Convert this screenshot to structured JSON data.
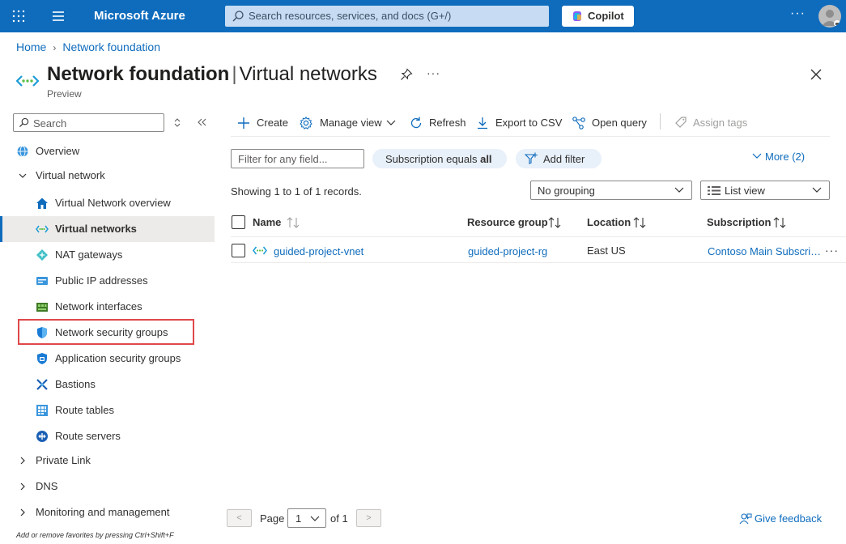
{
  "topbar": {
    "brand": "Microsoft Azure",
    "search_placeholder": "Search resources, services, and docs (G+/)",
    "copilot_label": "Copilot",
    "more": "···"
  },
  "breadcrumb": {
    "home": "Home",
    "current": "Network foundation"
  },
  "page": {
    "title_main": "Network foundation",
    "title_separator": "|",
    "title_sub": "Virtual networks",
    "subtitle": "Preview",
    "more": "···"
  },
  "nav": {
    "search_placeholder": "Search",
    "items": [
      {
        "label": "Overview",
        "icon": "globe-icon"
      },
      {
        "label": "Virtual network",
        "icon": "chevron-down-icon"
      },
      {
        "label": "Virtual Network overview",
        "icon": "home-icon"
      },
      {
        "label": "Virtual networks",
        "icon": "vnet-icon",
        "selected": true
      },
      {
        "label": "NAT gateways",
        "icon": "nat-gateway-icon"
      },
      {
        "label": "Public IP addresses",
        "icon": "public-ip-icon"
      },
      {
        "label": "Network interfaces",
        "icon": "network-interface-icon"
      },
      {
        "label": "Network security groups",
        "icon": "shield-icon",
        "highlighted": true
      },
      {
        "label": "Application security groups",
        "icon": "app-security-icon"
      },
      {
        "label": "Bastions",
        "icon": "bastion-icon"
      },
      {
        "label": "Route tables",
        "icon": "route-table-icon"
      },
      {
        "label": "Route servers",
        "icon": "route-server-icon"
      },
      {
        "label": "Private Link",
        "icon": "chevron-right-icon"
      },
      {
        "label": "DNS",
        "icon": "chevron-right-icon"
      },
      {
        "label": "Monitoring and management",
        "icon": "chevron-right-icon"
      }
    ],
    "footer": "Add or remove favorites by pressing Ctrl+Shift+F"
  },
  "toolbar": {
    "create": "Create",
    "manage_view": "Manage view",
    "refresh": "Refresh",
    "export_csv": "Export to CSV",
    "open_query": "Open query",
    "assign_tags": "Assign tags"
  },
  "filters": {
    "placeholder": "Filter for any field...",
    "subscription_prefix": "Subscription equals",
    "subscription_value": "all",
    "add_filter": "Add filter",
    "more": "More (2)"
  },
  "records_text": "Showing 1 to 1 of 1 records.",
  "grouping_value": "No grouping",
  "view_value": "List view",
  "table": {
    "columns": [
      "Name",
      "Resource group",
      "Location",
      "Subscription"
    ],
    "rows": [
      {
        "name": "guided-project-vnet",
        "resource_group": "guided-project-rg",
        "location": "East US",
        "subscription": "Contoso Main Subscri…"
      }
    ],
    "row_more": "···"
  },
  "pager": {
    "prev": "<",
    "page_label": "Page",
    "page_value": "1",
    "of_label": "of 1",
    "next": ">"
  },
  "feedback": "Give feedback",
  "colors": {
    "accent": "#0f6cbd",
    "highlight_border": "#e0484a"
  }
}
